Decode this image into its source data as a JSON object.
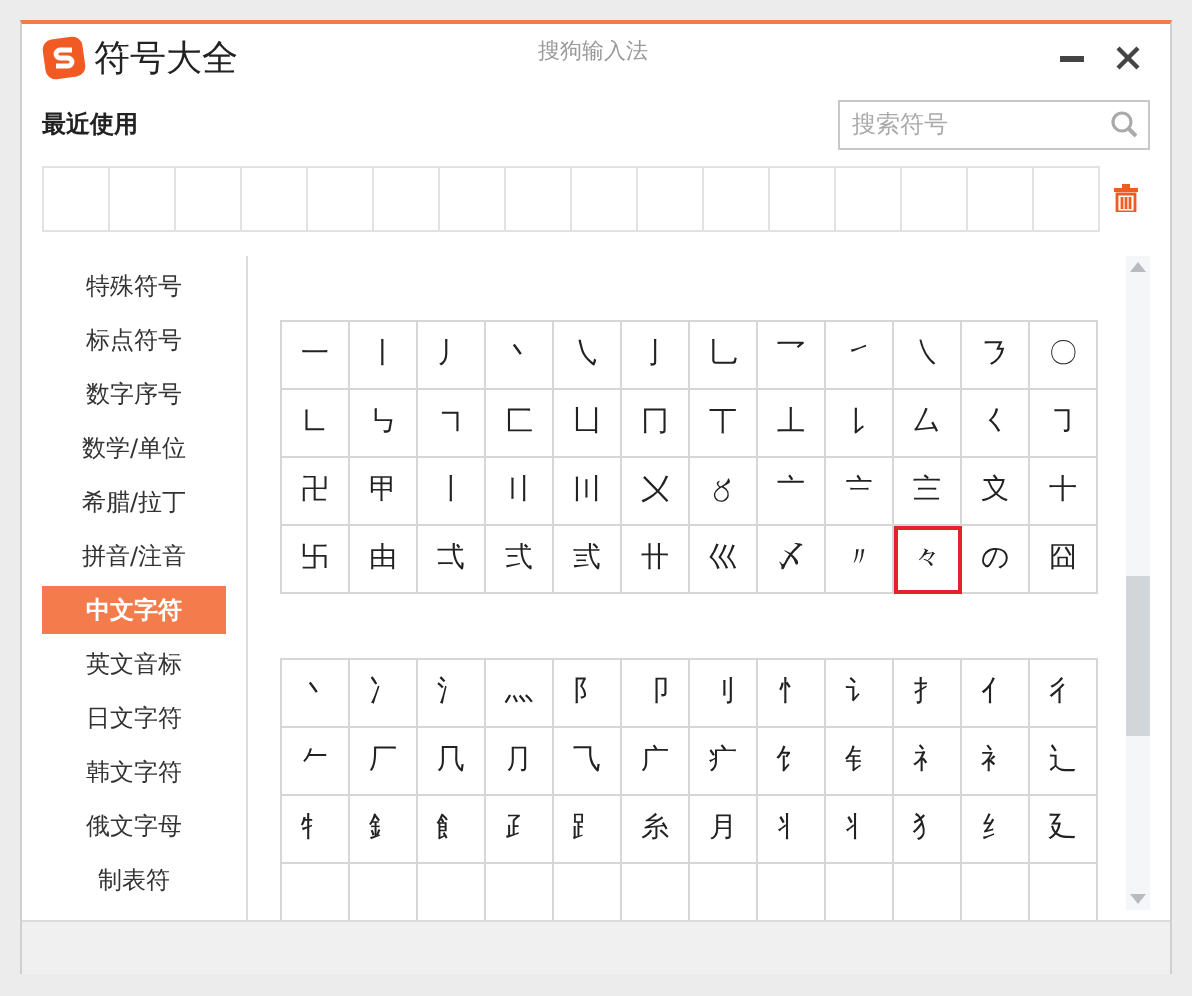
{
  "window": {
    "title": "符号大全",
    "subtitle": "搜狗输入法"
  },
  "recent": {
    "label": "最近使用"
  },
  "search": {
    "placeholder": "搜索符号"
  },
  "sidebar": {
    "items": [
      {
        "label": "特殊符号",
        "selected": false
      },
      {
        "label": "标点符号",
        "selected": false
      },
      {
        "label": "数字序号",
        "selected": false
      },
      {
        "label": "数学/单位",
        "selected": false
      },
      {
        "label": "希腊/拉丁",
        "selected": false
      },
      {
        "label": "拼音/注音",
        "selected": false
      },
      {
        "label": "中文字符",
        "selected": true
      },
      {
        "label": "英文音标",
        "selected": false
      },
      {
        "label": "日文字符",
        "selected": false
      },
      {
        "label": "韩文字符",
        "selected": false
      },
      {
        "label": "俄文字母",
        "selected": false
      },
      {
        "label": "制表符",
        "selected": false
      }
    ]
  },
  "grids": [
    {
      "rows": [
        [
          {
            "char": "一",
            "selected": false
          },
          {
            "char": "丨",
            "selected": false
          },
          {
            "char": "丿",
            "selected": false
          },
          {
            "char": "丶",
            "selected": false
          },
          {
            "char": "㇂",
            "selected": false
          },
          {
            "char": "亅",
            "selected": false
          },
          {
            "char": "乚",
            "selected": false
          },
          {
            "char": "乛",
            "selected": false
          },
          {
            "char": "㇀",
            "selected": false
          },
          {
            "char": "㇏",
            "selected": false
          },
          {
            "char": "㇋",
            "selected": false
          },
          {
            "char": "〇",
            "selected": false
          }
        ],
        [
          {
            "char": "㇗",
            "selected": false
          },
          {
            "char": "㇉",
            "selected": false
          },
          {
            "char": "㇕",
            "selected": false
          },
          {
            "char": "匚",
            "selected": false
          },
          {
            "char": "凵",
            "selected": false
          },
          {
            "char": "冂",
            "selected": false
          },
          {
            "char": "丅",
            "selected": false
          },
          {
            "char": "丄",
            "selected": false
          },
          {
            "char": "㇙",
            "selected": false
          },
          {
            "char": "厶",
            "selected": false
          },
          {
            "char": "㇛",
            "selected": false
          },
          {
            "char": "㇆",
            "selected": false
          }
        ],
        [
          {
            "char": "卍",
            "selected": false
          },
          {
            "char": "甲",
            "selected": false
          },
          {
            "char": "〡",
            "selected": false
          },
          {
            "char": "〢",
            "selected": false
          },
          {
            "char": "〣",
            "selected": false
          },
          {
            "char": "〤",
            "selected": false
          },
          {
            "char": "〥",
            "selected": false
          },
          {
            "char": "〦",
            "selected": false
          },
          {
            "char": "〧",
            "selected": false
          },
          {
            "char": "〨",
            "selected": false
          },
          {
            "char": "〩",
            "selected": false
          },
          {
            "char": "十",
            "selected": false
          }
        ],
        [
          {
            "char": "卐",
            "selected": false
          },
          {
            "char": "由",
            "selected": false
          },
          {
            "char": "弌",
            "selected": false
          },
          {
            "char": "弍",
            "selected": false
          },
          {
            "char": "弎",
            "selected": false
          },
          {
            "char": "卄",
            "selected": false
          },
          {
            "char": "巛",
            "selected": false
          },
          {
            "char": "〆",
            "selected": false
          },
          {
            "char": "〃",
            "selected": false
          },
          {
            "char": "々",
            "selected": true
          },
          {
            "char": "の",
            "selected": false
          },
          {
            "char": "囧",
            "selected": false
          }
        ]
      ]
    },
    {
      "rows": [
        [
          {
            "char": "丶",
            "selected": false
          },
          {
            "char": "冫",
            "selected": false
          },
          {
            "char": "氵",
            "selected": false
          },
          {
            "char": "灬",
            "selected": false
          },
          {
            "char": "阝",
            "selected": false
          },
          {
            "char": "卩",
            "selected": false
          },
          {
            "char": "刂",
            "selected": false
          },
          {
            "char": "忄",
            "selected": false
          },
          {
            "char": "讠",
            "selected": false
          },
          {
            "char": "扌",
            "selected": false
          },
          {
            "char": "亻",
            "selected": false
          },
          {
            "char": "彳",
            "selected": false
          }
        ],
        [
          {
            "char": "𠂉",
            "selected": false
          },
          {
            "char": "厂",
            "selected": false
          },
          {
            "char": "⺇",
            "selected": false
          },
          {
            "char": "⺆",
            "selected": false
          },
          {
            "char": "⺄",
            "selected": false
          },
          {
            "char": "广",
            "selected": false
          },
          {
            "char": "疒",
            "selected": false
          },
          {
            "char": "饣",
            "selected": false
          },
          {
            "char": "钅",
            "selected": false
          },
          {
            "char": "礻",
            "selected": false
          },
          {
            "char": "衤",
            "selected": false
          },
          {
            "char": "辶",
            "selected": false
          }
        ],
        [
          {
            "char": "牜",
            "selected": false
          },
          {
            "char": "釒",
            "selected": false
          },
          {
            "char": "飠",
            "selected": false
          },
          {
            "char": "⺪",
            "selected": false
          },
          {
            "char": "⻊",
            "selected": false
          },
          {
            "char": "糸",
            "selected": false
          },
          {
            "char": "月",
            "selected": false
          },
          {
            "char": "丬",
            "selected": false
          },
          {
            "char": "⺦",
            "selected": false
          },
          {
            "char": "犭",
            "selected": false
          },
          {
            "char": "纟",
            "selected": false
          },
          {
            "char": "廴",
            "selected": false
          }
        ]
      ]
    }
  ]
}
